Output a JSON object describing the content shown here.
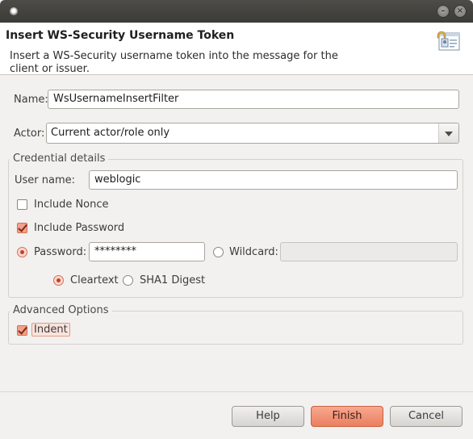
{
  "window": {
    "title_bar_buttons": [
      "minimize",
      "close"
    ]
  },
  "header": {
    "title": "Insert WS-Security Username Token",
    "description": "Insert a WS-Security username token into the message for the client or issuer.",
    "icon": "wizard-banner-icon"
  },
  "form": {
    "name_label": "Name:",
    "name_value": "WsUsernameInsertFilter",
    "actor_label": "Actor:",
    "actor_value": "Current actor/role only"
  },
  "credential": {
    "group_title": "Credential details",
    "username_label": "User name:",
    "username_value": "weblogic",
    "include_nonce_label": "Include Nonce",
    "include_nonce_checked": false,
    "include_password_label": "Include Password",
    "include_password_checked": true,
    "password_label": "Password:",
    "password_value": "********",
    "password_selected": true,
    "wildcard_label": "Wildcard:",
    "wildcard_selected": false,
    "wildcard_value": "",
    "cleartext_label": "Cleartext",
    "cleartext_selected": true,
    "sha1_label": "SHA1 Digest",
    "sha1_selected": false
  },
  "advanced": {
    "group_title": "Advanced Options",
    "indent_label": "Indent",
    "indent_checked": true
  },
  "buttons": {
    "help": "Help",
    "finish": "Finish",
    "cancel": "Cancel"
  },
  "colors": {
    "accent": "#ec7f5f",
    "title_bar": "#3c3b37"
  }
}
